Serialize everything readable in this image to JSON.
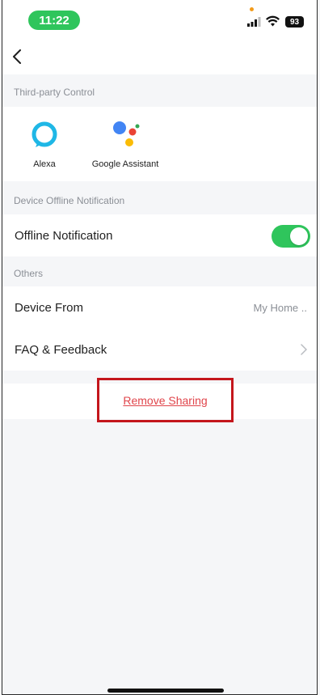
{
  "status_bar": {
    "time": "11:22",
    "battery": "93"
  },
  "third_party": {
    "header": "Third-party Control",
    "items": [
      {
        "label": "Alexa",
        "icon": "alexa-icon"
      },
      {
        "label": "Google Assistant",
        "icon": "google-assistant-icon"
      }
    ]
  },
  "offline": {
    "header": "Device Offline Notification",
    "label": "Offline Notification",
    "enabled": true
  },
  "others": {
    "header": "Others",
    "device_from_label": "Device From",
    "device_from_value": "My Home ..",
    "faq_label": "FAQ & Feedback"
  },
  "remove_sharing": "Remove Sharing",
  "colors": {
    "accent": "#2fc55c",
    "danger": "#e0444a",
    "highlight_box": "#c4161c"
  }
}
